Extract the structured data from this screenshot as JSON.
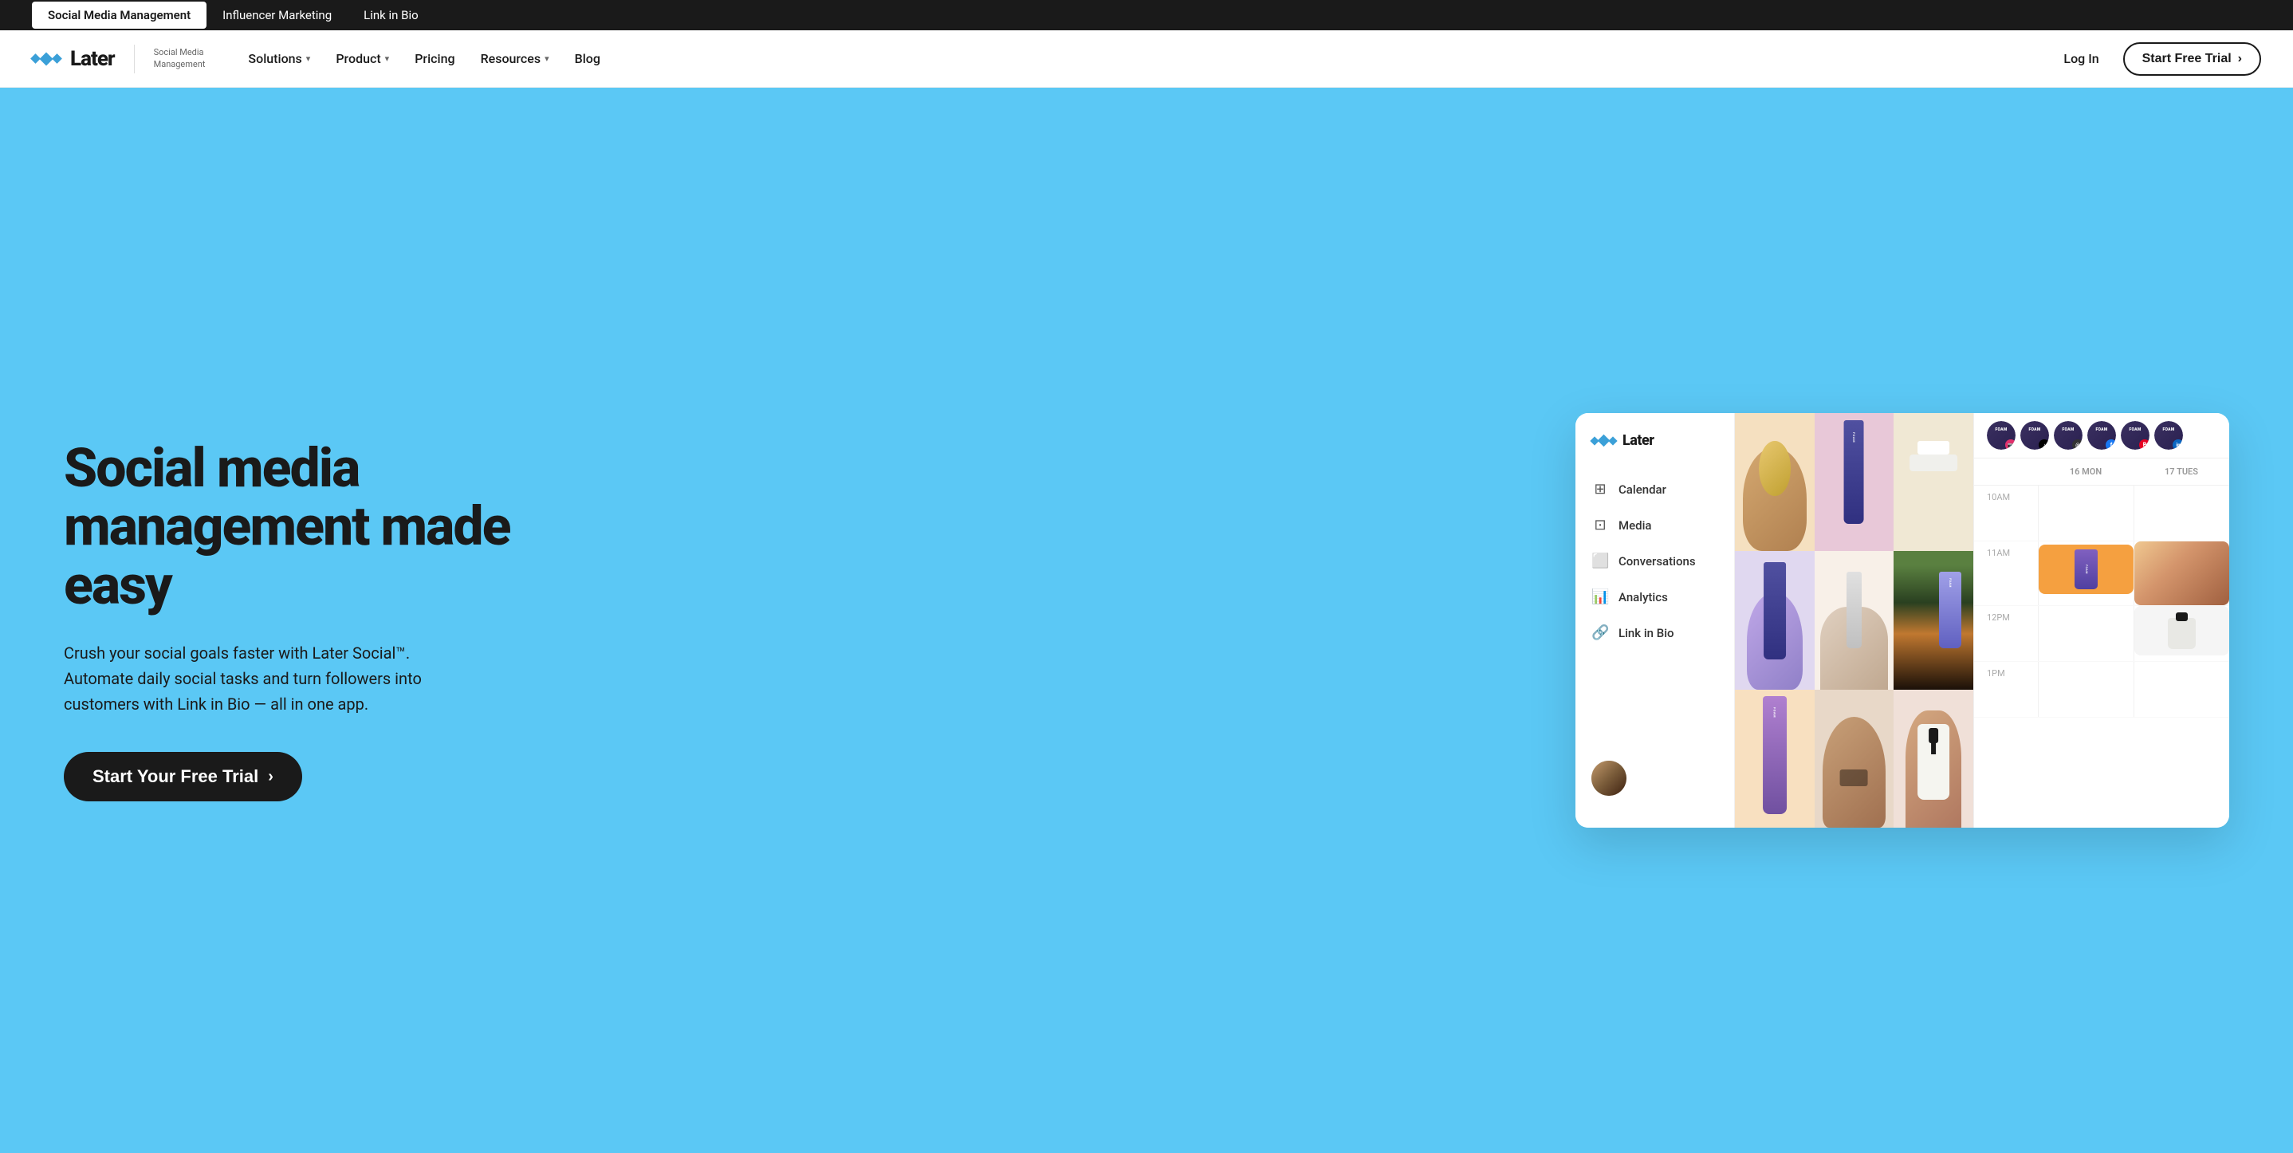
{
  "topBanner": {
    "items": [
      {
        "id": "social-media-management",
        "label": "Social Media Management",
        "active": true
      },
      {
        "id": "influencer-marketing",
        "label": "Influencer Marketing",
        "active": false
      },
      {
        "id": "link-in-bio",
        "label": "Link in Bio",
        "active": false
      }
    ]
  },
  "nav": {
    "logo": {
      "text": "Later",
      "subtitle": "Social Media\nManagement"
    },
    "items": [
      {
        "id": "solutions",
        "label": "Solutions",
        "hasDropdown": true
      },
      {
        "id": "product",
        "label": "Product",
        "hasDropdown": true
      },
      {
        "id": "pricing",
        "label": "Pricing",
        "hasDropdown": false
      },
      {
        "id": "resources",
        "label": "Resources",
        "hasDropdown": true
      },
      {
        "id": "blog",
        "label": "Blog",
        "hasDropdown": false
      }
    ],
    "loginLabel": "Log In",
    "trialLabel": "Start Free Trial"
  },
  "hero": {
    "heading": "Social media management made easy",
    "subtext": "Crush your social goals faster with Later Social™. Automate daily social tasks and turn followers into customers with Link in Bio — all in one app.",
    "ctaLabel": "Start Your Free Trial"
  },
  "appMockup": {
    "logo": "Later",
    "sidebarItems": [
      {
        "id": "calendar",
        "label": "Calendar",
        "icon": "calendar"
      },
      {
        "id": "media",
        "label": "Media",
        "icon": "media"
      },
      {
        "id": "conversations",
        "label": "Conversations",
        "icon": "chat"
      },
      {
        "id": "analytics",
        "label": "Analytics",
        "icon": "analytics"
      },
      {
        "id": "link-in-bio",
        "label": "Link in Bio",
        "icon": "link"
      }
    ],
    "calendar": {
      "days": [
        {
          "number": "16",
          "day": "MON"
        },
        {
          "number": "17",
          "day": "TUES"
        }
      ],
      "timeSlots": [
        {
          "time": "10AM"
        },
        {
          "time": "11AM"
        },
        {
          "time": "12PM"
        },
        {
          "time": "1PM"
        }
      ]
    },
    "socialPlatforms": [
      {
        "id": "instagram",
        "type": "ig",
        "label": "FOAM"
      },
      {
        "id": "tiktok",
        "type": "tk",
        "label": "FOAM"
      },
      {
        "id": "threads",
        "type": "th",
        "label": "FOAM"
      },
      {
        "id": "facebook",
        "type": "fb",
        "label": "FOAM"
      },
      {
        "id": "pinterest",
        "type": "pi",
        "label": "FOAM"
      },
      {
        "id": "linkedin",
        "type": "li",
        "label": "FOAM"
      }
    ]
  }
}
